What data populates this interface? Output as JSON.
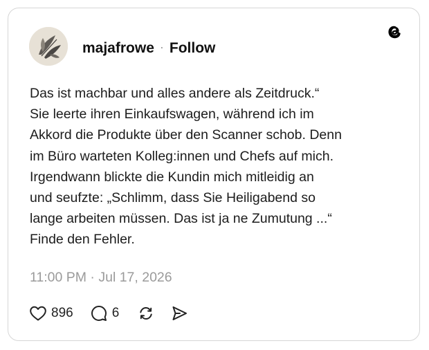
{
  "post": {
    "username": "majafrowe",
    "separator": "·",
    "follow_label": "Follow",
    "text_lines": [
      "Das ist machbar und alles andere als Zeitdruck.“",
      "Sie leerte ihren Einkaufswagen, während ich im",
      "Akkord die Produkte über den Scanner schob. Denn",
      "im Büro warteten Kolleg:innen und Chefs auf mich.",
      "Irgendwann blickte die Kundin  mich mitleidig an",
      "und seufzte: „Schlimm, dass Sie Heiligabend so",
      "lange arbeiten müssen. Das ist ja ne Zumutung ...“",
      "Finde den Fehler."
    ],
    "timestamp": "11:00 PM · Jul 17, 2026"
  },
  "actions": {
    "likes": "896",
    "replies": "6"
  },
  "icons": {
    "brand": "threads-logo-icon",
    "like": "heart-icon",
    "reply": "speech-bubble-icon",
    "repost": "repost-icon",
    "share": "send-icon"
  },
  "colors": {
    "text": "#1c1c1c",
    "muted": "#9a9a9a",
    "border": "#d6d6d6"
  }
}
